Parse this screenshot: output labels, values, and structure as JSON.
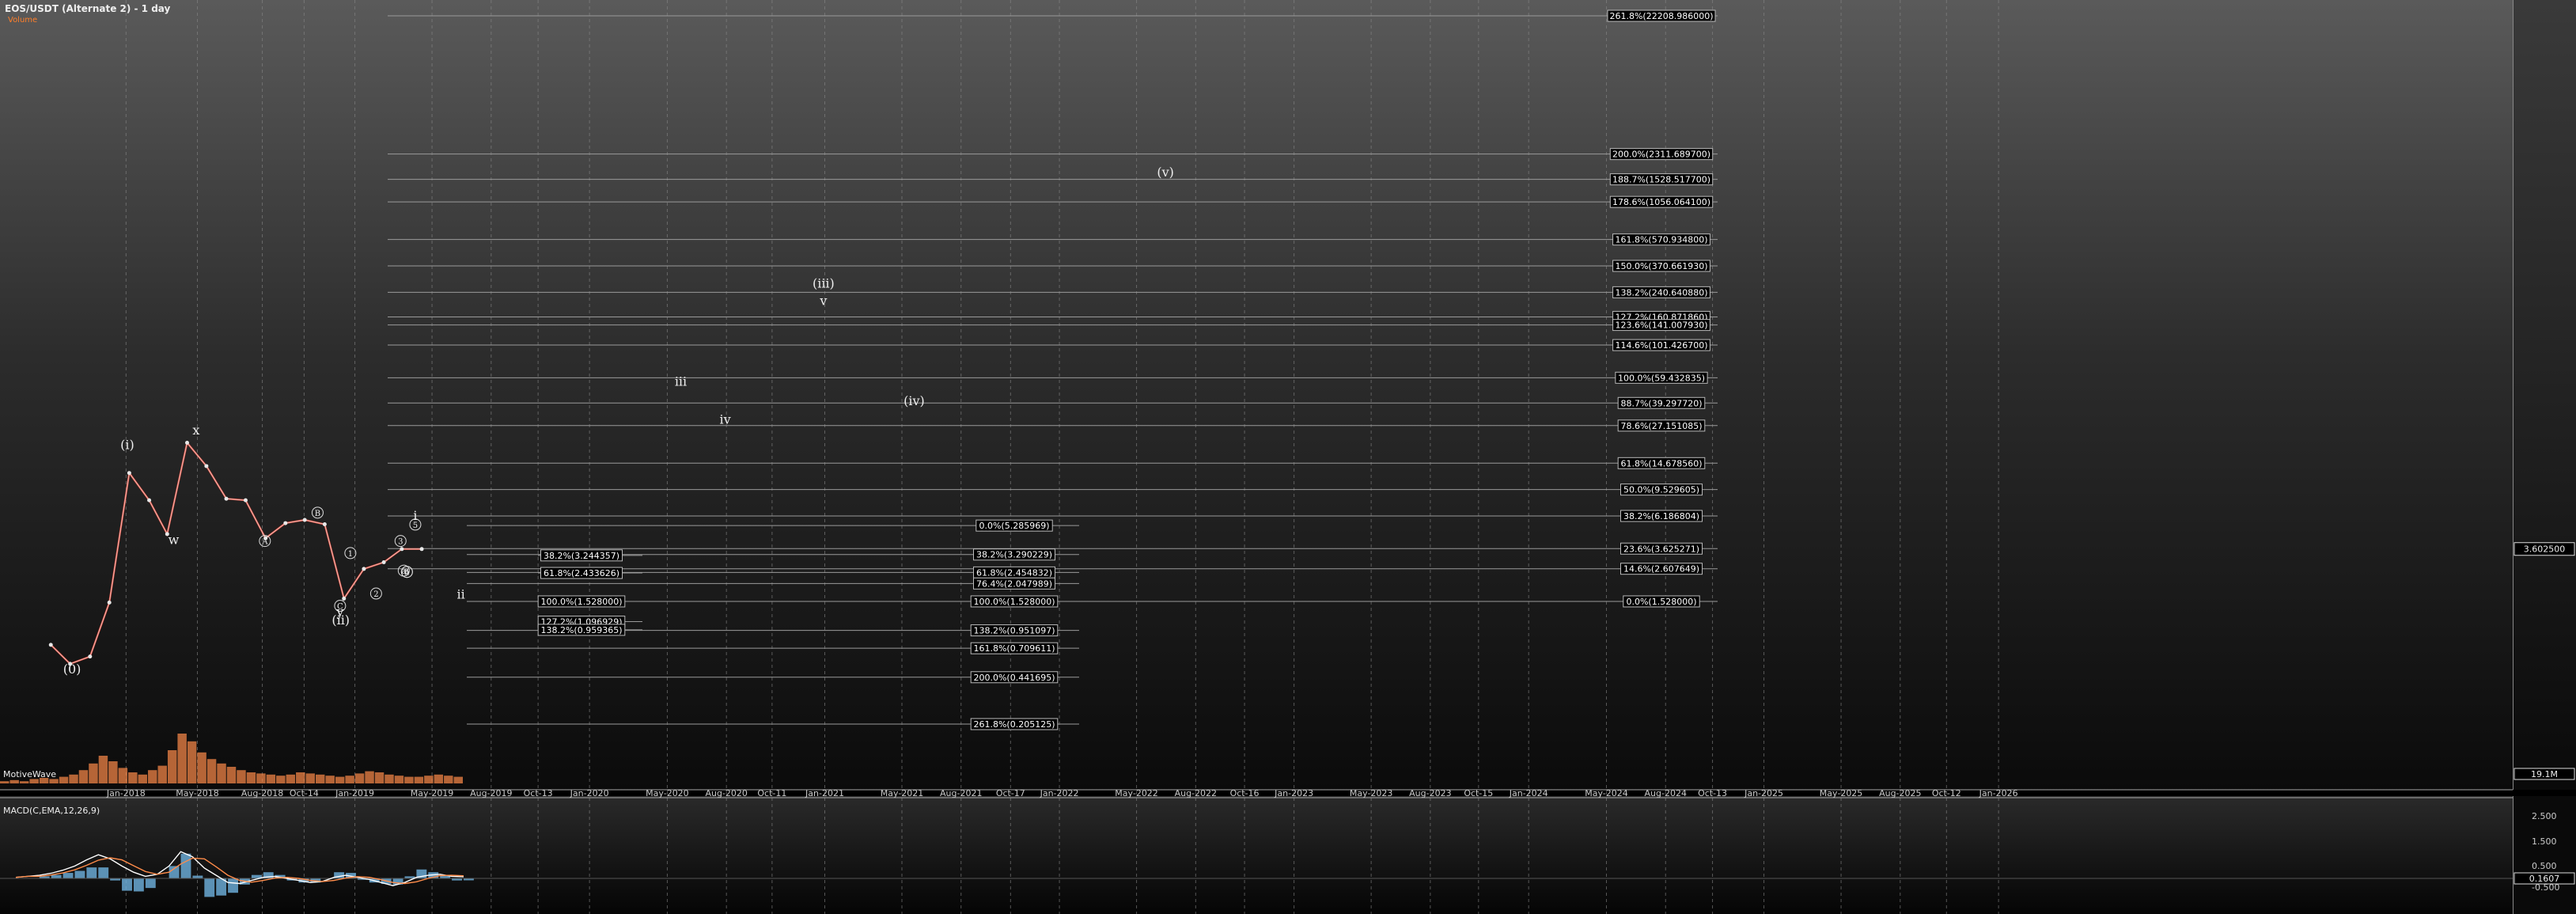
{
  "header": {
    "title": "EOS/USDT (Alternate 2) - 1 day",
    "volume_label": "Volume"
  },
  "volume_pane": {
    "label": "MotiveWave",
    "last_value": "19.1M"
  },
  "macd_pane": {
    "label": "MACD(C,EMA,12,26,9)",
    "ticks": [
      "2.500",
      "1.500",
      "0.500",
      "-0.500"
    ],
    "last_value": "0.1607"
  },
  "price_axis": {
    "last_price": "3.602500"
  },
  "colors": {
    "up": "#e8e8e8",
    "down": "#ff5b4a",
    "volume_up": "#ff8c4a",
    "macd_line": "#ffffff",
    "signal_line": "#ff8c4a",
    "histogram": "#6fb3e0",
    "fib_line": "#9a9a9a",
    "accent": "#ff7f2a"
  },
  "chart_data": {
    "type": "line",
    "title": "EOS/USDT (Alternate 2) - 1 day",
    "x_ticks": [
      "Jan-2018",
      "May-2018",
      "Aug-2018",
      "Oct-14",
      "Jan-2019",
      "May-2019",
      "Aug-2019",
      "Oct-13",
      "Jan-2020",
      "May-2020",
      "Aug-2020",
      "Oct-11",
      "Jan-2021",
      "May-2021",
      "Aug-2021",
      "Oct-17",
      "Jan-2022",
      "May-2022",
      "Aug-2022",
      "Oct-16",
      "Jan-2023",
      "May-2023",
      "Aug-2023",
      "Oct-15",
      "Jan-2024",
      "May-2024",
      "Aug-2024",
      "Oct-13",
      "Jan-2025",
      "May-2025",
      "Aug-2025",
      "Oct-12",
      "Jan-2026"
    ],
    "log_scale": true,
    "grid": true,
    "series": [
      {
        "name": "EOS/USDT",
        "values": [
          {
            "t": "2017-09",
            "p": 0.75
          },
          {
            "t": "2017-10",
            "p": 0.55
          },
          {
            "t": "2017-11",
            "p": 0.62
          },
          {
            "t": "2017-12",
            "p": 1.5
          },
          {
            "t": "2018-01",
            "p": 12.5
          },
          {
            "t": "2018-02",
            "p": 8.0
          },
          {
            "t": "2018-03",
            "p": 4.6
          },
          {
            "t": "2018-04",
            "p": 20.5
          },
          {
            "t": "2018-05",
            "p": 14.0
          },
          {
            "t": "2018-06",
            "p": 8.2
          },
          {
            "t": "2018-07",
            "p": 8.0
          },
          {
            "t": "2018-08",
            "p": 4.3
          },
          {
            "t": "2018-09",
            "p": 5.5
          },
          {
            "t": "2018-10",
            "p": 5.8
          },
          {
            "t": "2018-11",
            "p": 5.4
          },
          {
            "t": "2018-12",
            "p": 1.6
          },
          {
            "t": "2019-01",
            "p": 2.6
          },
          {
            "t": "2019-02",
            "p": 2.9
          },
          {
            "t": "2019-03",
            "p": 3.6
          },
          {
            "t": "2019-04",
            "p": 3.6
          }
        ]
      }
    ],
    "wave_labels": [
      {
        "text": "(0)",
        "t": "2017-10-18",
        "p": 0.47
      },
      {
        "text": "(i)",
        "t": "2018-01-12",
        "p": 18.5
      },
      {
        "text": "w",
        "t": "2018-03-25",
        "p": 3.9
      },
      {
        "text": "x",
        "t": "2018-04-29",
        "p": 23.5
      },
      {
        "text": "A",
        "t": "2018-08-14",
        "p": 3.9
      },
      {
        "text": "B",
        "t": "2018-11-04",
        "p": 6.2
      },
      {
        "text": "C",
        "t": "2018-12-09",
        "p": 1.35
      },
      {
        "text": "y",
        "t": "2018-12-09",
        "p": 1.2
      },
      {
        "text": "(ii)",
        "t": "2018-12-10",
        "p": 1.05
      },
      {
        "text": "1",
        "t": "2018-12-25",
        "p": 3.2
      },
      {
        "text": "2",
        "t": "2019-02-03",
        "p": 1.65
      },
      {
        "text": "3",
        "t": "2019-03-13",
        "p": 3.9
      },
      {
        "text": "4",
        "t": "2019-03-23",
        "p": 2.35
      },
      {
        "text": "5",
        "t": "2019-04-05",
        "p": 5.1
      },
      {
        "text": "a",
        "t": "2019-03-18",
        "p": 2.4
      },
      {
        "text": "b",
        "t": "2019-03-23",
        "p": 2.35
      },
      {
        "text": "i",
        "t": "2019-04-05",
        "p": 5.8
      },
      {
        "text": "ii",
        "t": "2019-06-15",
        "p": 1.6
      },
      {
        "text": "iii",
        "t": "2020-05-22",
        "p": 52
      },
      {
        "text": "iv",
        "t": "2020-07-30",
        "p": 28
      },
      {
        "text": "(iii)",
        "t": "2020-12-30",
        "p": 260
      },
      {
        "text": "v",
        "t": "2020-12-30",
        "p": 195
      },
      {
        "text": "(iv)",
        "t": "2021-05-20",
        "p": 38
      },
      {
        "text": "(v)",
        "t": "2022-06-15",
        "p": 1600
      }
    ],
    "fib_levels": [
      {
        "label": "261.8%(22208.986000)",
        "value": 22208.986
      },
      {
        "label": "200.0%(2311.689700)",
        "value": 2311.6897
      },
      {
        "label": "188.7%(1528.517700)",
        "value": 1528.5177
      },
      {
        "label": "178.6%(1056.064100)",
        "value": 1056.0641
      },
      {
        "label": "161.8%(570.934800)",
        "value": 570.9348
      },
      {
        "label": "150.0%(370.661930)",
        "value": 370.66193
      },
      {
        "label": "138.2%(240.640880)",
        "value": 240.64088
      },
      {
        "label": "127.2%(160.871860)",
        "value": 160.87186
      },
      {
        "label": "123.6%(141.007930)",
        "value": 141.00793
      },
      {
        "label": "114.6%(101.426700)",
        "value": 101.4267
      },
      {
        "label": "100.0%(59.432835)",
        "value": 59.432835
      },
      {
        "label": "88.7%(39.297720)",
        "value": 39.29772
      },
      {
        "label": "78.6%(27.151085)",
        "value": 27.151085
      },
      {
        "label": "61.8%(14.678560)",
        "value": 14.67856
      },
      {
        "label": "50.0%(9.529605)",
        "value": 9.529605
      },
      {
        "label": "38.2%(6.186804)",
        "value": 6.186804
      },
      {
        "label": "23.6%(3.625271)",
        "value": 3.625271
      },
      {
        "label": "14.6%(2.607649)",
        "value": 2.607649
      },
      {
        "label": "0.0%(1.528000)",
        "value": 1.528
      },
      {
        "label": "0.0%(5.285969)",
        "value": 5.285969
      },
      {
        "label": "38.2%(3.290229)",
        "value": 3.290229
      },
      {
        "label": "61.8%(2.454832)",
        "value": 2.454832
      },
      {
        "label": "76.4%(2.047989)",
        "value": 2.047989
      },
      {
        "label": "100.0%(1.528000)",
        "value": 1.528
      },
      {
        "label": "138.2%(0.951097)",
        "value": 0.951097
      },
      {
        "label": "161.8%(0.709611)",
        "value": 0.709611
      },
      {
        "label": "200.0%(0.441695)",
        "value": 0.441695
      },
      {
        "label": "261.8%(0.205125)",
        "value": 0.205125
      },
      {
        "label": "38.2%(3.244357)",
        "value": 3.244357
      },
      {
        "label": "61.8%(2.433626)",
        "value": 2.433626
      },
      {
        "label": "100.0%(1.528000)",
        "value": 1.528
      },
      {
        "label": "127.2%(1.096929)",
        "value": 1.096929
      },
      {
        "label": "138.2%(0.959365)",
        "value": 0.959365
      }
    ]
  }
}
